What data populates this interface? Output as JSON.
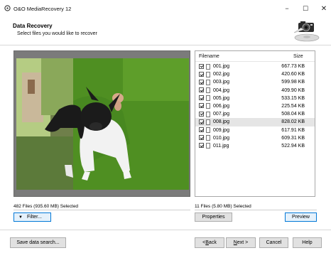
{
  "window": {
    "title": "O&O MediaRecovery 12",
    "controls": {
      "minimize": "−",
      "maximize": "☐",
      "close": "✕"
    }
  },
  "header": {
    "title": "Data Recovery",
    "subtitle": "Select files you would like to recover",
    "logo_icon": "camera-disk-logo-icon"
  },
  "file_list": {
    "columns": {
      "filename": "Filename",
      "size": "Size"
    },
    "selected_index": 7,
    "rows": [
      {
        "name": "001.jpg",
        "size": "667.73 KB",
        "checked": true
      },
      {
        "name": "002.jpg",
        "size": "420.60 KB",
        "checked": true
      },
      {
        "name": "003.jpg",
        "size": "599.98 KB",
        "checked": true
      },
      {
        "name": "004.jpg",
        "size": "409.90 KB",
        "checked": true
      },
      {
        "name": "005.jpg",
        "size": "533.15 KB",
        "checked": true
      },
      {
        "name": "006.jpg",
        "size": "225.54 KB",
        "checked": true
      },
      {
        "name": "007.jpg",
        "size": "508.04 KB",
        "checked": true
      },
      {
        "name": "008.jpg",
        "size": "828.02 KB",
        "checked": true
      },
      {
        "name": "009.jpg",
        "size": "617.91 KB",
        "checked": true
      },
      {
        "name": "010.jpg",
        "size": "609.31 KB",
        "checked": true
      },
      {
        "name": "011.jpg",
        "size": "522.94 KB",
        "checked": true
      }
    ]
  },
  "status": {
    "left": "482 Files (935.60 MB) Selected",
    "right": "11 Files (5.80 MB) Selected"
  },
  "buttons": {
    "filter": "Filter...",
    "properties": "Properties",
    "preview": "Preview",
    "save_search": "Save data search...",
    "back_prefix": "< ",
    "back_key": "B",
    "back_rest": "ack",
    "next_key": "N",
    "next_rest": "ext >",
    "cancel": "Cancel",
    "help": "Help"
  },
  "colors": {
    "accent": "#0078d7",
    "button_face": "#e1e1e1",
    "selected_row": "#e5e5e5",
    "preview_bg": "#7b7b7b"
  }
}
